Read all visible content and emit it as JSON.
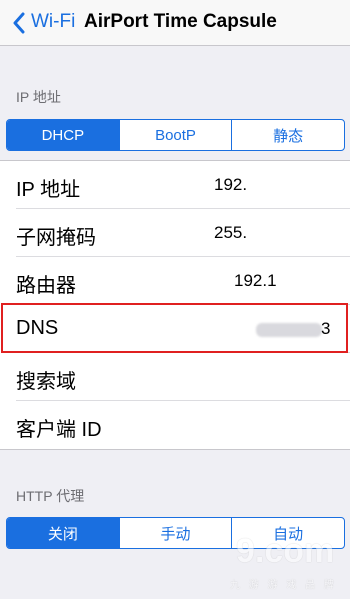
{
  "navbar": {
    "back_label": "Wi-Fi",
    "title": "AirPort Time Capsule"
  },
  "ip_section": {
    "header": "IP 地址",
    "segments": [
      "DHCP",
      "BootP",
      "静态"
    ],
    "selected_segment": "DHCP"
  },
  "rows": [
    {
      "label": "IP 地址",
      "value": "192."
    },
    {
      "label": "子网掩码",
      "value": "255."
    },
    {
      "label": "路由器",
      "value": "192.1"
    },
    {
      "label": "DNS",
      "value": "3"
    },
    {
      "label": "搜索域",
      "value": ""
    },
    {
      "label": "客户端 ID",
      "value": ""
    }
  ],
  "http_section": {
    "header": "HTTP 代理",
    "segments": [
      "关闭",
      "手动",
      "自动"
    ],
    "selected_segment": "关闭"
  },
  "watermark": {
    "big": "9.com",
    "small": "九 游 游 戏 品 牌"
  },
  "colors": {
    "accent": "#1a6fe0",
    "highlight": "#e02020",
    "background": "#efeff4"
  }
}
